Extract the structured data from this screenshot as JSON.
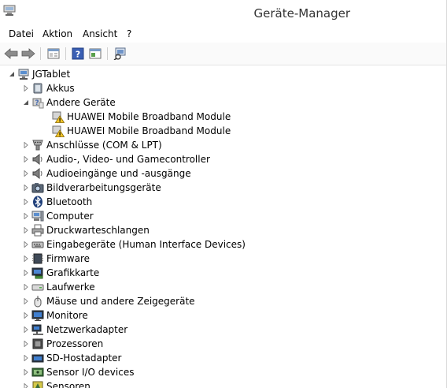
{
  "window": {
    "title": "Geräte-Manager"
  },
  "menu": [
    "Datei",
    "Aktion",
    "Ansicht",
    "?"
  ],
  "toolbar": {
    "back": "back-arrow-icon",
    "forward": "forward-arrow-icon",
    "properties": "properties-icon",
    "help": "help-icon",
    "show_hide": "show-hide-pane-icon",
    "scan": "scan-hardware-icon"
  },
  "tree": {
    "root": "JGTablet",
    "items": [
      {
        "label": "Akkus",
        "icon": "battery-icon",
        "expanded": false
      },
      {
        "label": "Andere Geräte",
        "icon": "unknown-device-icon",
        "expanded": true,
        "children": [
          {
            "label": "HUAWEI Mobile Broadband Module",
            "icon": "warning-device-icon"
          },
          {
            "label": "HUAWEI Mobile Broadband Module",
            "icon": "warning-device-icon"
          }
        ]
      },
      {
        "label": "Anschlüsse (COM & LPT)",
        "icon": "port-icon",
        "expanded": false
      },
      {
        "label": "Audio-, Video- und Gamecontroller",
        "icon": "speaker-icon",
        "expanded": false
      },
      {
        "label": "Audioeingänge und -ausgänge",
        "icon": "speaker-icon",
        "expanded": false
      },
      {
        "label": "Bildverarbeitungsgeräte",
        "icon": "camera-icon",
        "expanded": false
      },
      {
        "label": "Bluetooth",
        "icon": "bluetooth-icon",
        "expanded": false
      },
      {
        "label": "Computer",
        "icon": "computer-icon",
        "expanded": false
      },
      {
        "label": "Druckwarteschlangen",
        "icon": "printer-icon",
        "expanded": false
      },
      {
        "label": "Eingabegeräte (Human Interface Devices)",
        "icon": "hid-icon",
        "expanded": false
      },
      {
        "label": "Firmware",
        "icon": "firmware-icon",
        "expanded": false
      },
      {
        "label": "Grafikkarte",
        "icon": "display-adapter-icon",
        "expanded": false
      },
      {
        "label": "Laufwerke",
        "icon": "drive-icon",
        "expanded": false
      },
      {
        "label": "Mäuse und andere Zeigegeräte",
        "icon": "mouse-icon",
        "expanded": false
      },
      {
        "label": "Monitore",
        "icon": "monitor-icon",
        "expanded": false
      },
      {
        "label": "Netzwerkadapter",
        "icon": "network-icon",
        "expanded": false
      },
      {
        "label": "Prozessoren",
        "icon": "processor-icon",
        "expanded": false
      },
      {
        "label": "SD-Hostadapter",
        "icon": "sd-icon",
        "expanded": false
      },
      {
        "label": "Sensor I/O devices",
        "icon": "sensor-io-icon",
        "expanded": false
      },
      {
        "label": "Sensoren",
        "icon": "sensor-icon",
        "expanded": false
      }
    ]
  }
}
